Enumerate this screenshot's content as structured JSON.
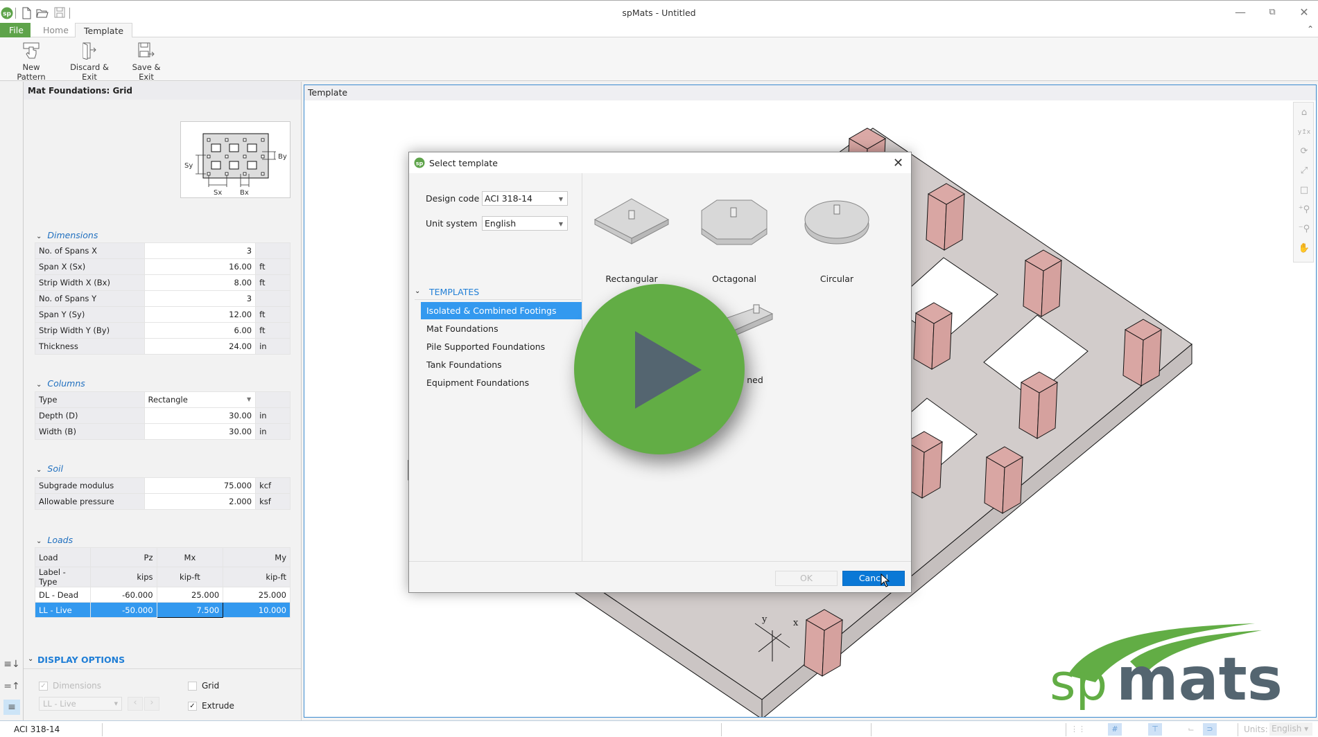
{
  "window": {
    "title": "spMats - Untitled",
    "app_logo_text": "sp"
  },
  "quick_access": [
    "new-file-icon",
    "open-folder-icon",
    "save-icon"
  ],
  "ribbon": {
    "tabs": [
      {
        "label": "File",
        "active": false
      },
      {
        "label": "Home",
        "active": false
      },
      {
        "label": "Template",
        "active": true
      }
    ],
    "buttons": [
      {
        "label": "New Pattern",
        "icon": "pointer-hand-icon"
      },
      {
        "label": "Discard & Exit",
        "icon": "exit-door-icon"
      },
      {
        "label": "Save & Exit",
        "icon": "save-exit-icon"
      }
    ]
  },
  "left_panel": {
    "header": "Mat Foundations: Grid",
    "preview_labels": {
      "sy": "Sy",
      "by": "By",
      "sx": "Sx",
      "bx": "Bx"
    },
    "dimensions": {
      "title": "Dimensions",
      "rows": [
        {
          "label": "No. of Spans X",
          "value": "3",
          "unit": ""
        },
        {
          "label": "Span X (Sx)",
          "value": "16.00",
          "unit": "ft"
        },
        {
          "label": "Strip Width X (Bx)",
          "value": "8.00",
          "unit": "ft"
        },
        {
          "label": "No. of Spans Y",
          "value": "3",
          "unit": ""
        },
        {
          "label": "Span Y (Sy)",
          "value": "12.00",
          "unit": "ft"
        },
        {
          "label": "Strip Width Y (By)",
          "value": "6.00",
          "unit": "ft"
        },
        {
          "label": "Thickness",
          "value": "24.00",
          "unit": "in"
        }
      ]
    },
    "columns": {
      "title": "Columns",
      "type_label": "Type",
      "type_value": "Rectangle",
      "rows": [
        {
          "label": "Depth (D)",
          "value": "30.00",
          "unit": "in"
        },
        {
          "label": "Width (B)",
          "value": "30.00",
          "unit": "in"
        }
      ]
    },
    "soil": {
      "title": "Soil",
      "rows": [
        {
          "label": "Subgrade modulus",
          "value": "75.000",
          "unit": "kcf"
        },
        {
          "label": "Allowable pressure",
          "value": "2.000",
          "unit": "ksf"
        }
      ]
    },
    "loads": {
      "title": "Loads",
      "header1": [
        "Load",
        "Pz",
        "Mx",
        "My"
      ],
      "header2": [
        "Label - Type",
        "kips",
        "kip-ft",
        "kip-ft"
      ],
      "rows": [
        {
          "label": "DL - Dead",
          "pz": "-60.000",
          "mx": "25.000",
          "my": "25.000",
          "selected": false
        },
        {
          "label": "LL - Live",
          "pz": "-50.000",
          "mx": "7.500",
          "my": "10.000",
          "selected": true
        }
      ]
    },
    "display_options": {
      "title": "DISPLAY OPTIONS",
      "dimensions_label": "Dimensions",
      "dimensions_checked": true,
      "dimensions_enabled": false,
      "load_case_value": "LL - Live",
      "grid_label": "Grid",
      "grid_checked": false,
      "extrude_label": "Extrude",
      "extrude_checked": true
    }
  },
  "viewport": {
    "header": "Template",
    "toolbar": [
      "home-view-icon",
      "axes-view-icon",
      "rotate-icon",
      "zoom-extents-icon",
      "zoom-window-icon",
      "zoom-in-icon",
      "zoom-out-icon",
      "pan-hand-icon"
    ],
    "axis_labels": {
      "y": "y",
      "x": "x"
    }
  },
  "dialog": {
    "title": "Select template",
    "design_code_label": "Design code",
    "design_code_value": "ACI 318-14",
    "unit_system_label": "Unit system",
    "unit_system_value": "English",
    "templates_header": "TEMPLATES",
    "categories": [
      {
        "label": "Isolated & Combined Footings",
        "selected": true
      },
      {
        "label": "Mat Foundations",
        "selected": false
      },
      {
        "label": "Pile Supported Foundations",
        "selected": false
      },
      {
        "label": "Tank Foundations",
        "selected": false
      },
      {
        "label": "Equipment Foundations",
        "selected": false
      }
    ],
    "templates": [
      {
        "label": "Rectangular",
        "shape": "rectangular"
      },
      {
        "label": "Octagonal",
        "shape": "octagonal"
      },
      {
        "label": "Circular",
        "shape": "circular"
      },
      {
        "label": "ned",
        "shape": "combined"
      }
    ],
    "ok_label": "OK",
    "ok_enabled": false,
    "cancel_label": "Cancel"
  },
  "status_bar": {
    "design_code": "ACI 318-14",
    "units_label": "Units:",
    "units_value": "English"
  },
  "overlay": {
    "type": "video-play-button",
    "color": "#62ad45"
  },
  "logo": {
    "prefix": "sp",
    "name": "mats",
    "green": "#62ad45",
    "slate": "#546570"
  },
  "colors": {
    "accent_blue": "#3399ef",
    "button_blue": "#0a78d6",
    "file_tab_green": "#5ea34a",
    "column_pink": "#d9a6a3",
    "mat_gray": "#d2cccb"
  }
}
